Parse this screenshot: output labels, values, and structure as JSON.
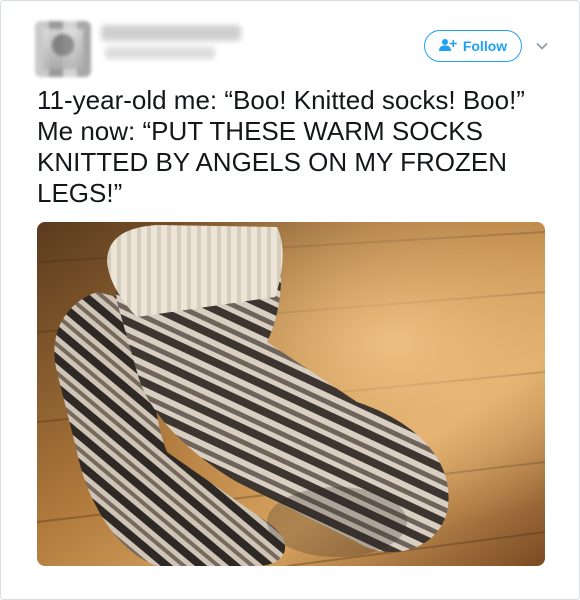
{
  "header": {
    "follow_label": "Follow",
    "follow_icon": "add-user-icon",
    "menu_icon": "chevron-down-icon"
  },
  "tweet": {
    "text": "11-year-old me: “Boo! Knitted socks! Boo!” Me now: “PUT THESE WARM SOCKS KNITTED BY ANGELS ON MY FROZEN LEGS!”"
  },
  "colors": {
    "accent": "#1da1f2",
    "text": "#14171a",
    "border": "#d8dee3"
  }
}
